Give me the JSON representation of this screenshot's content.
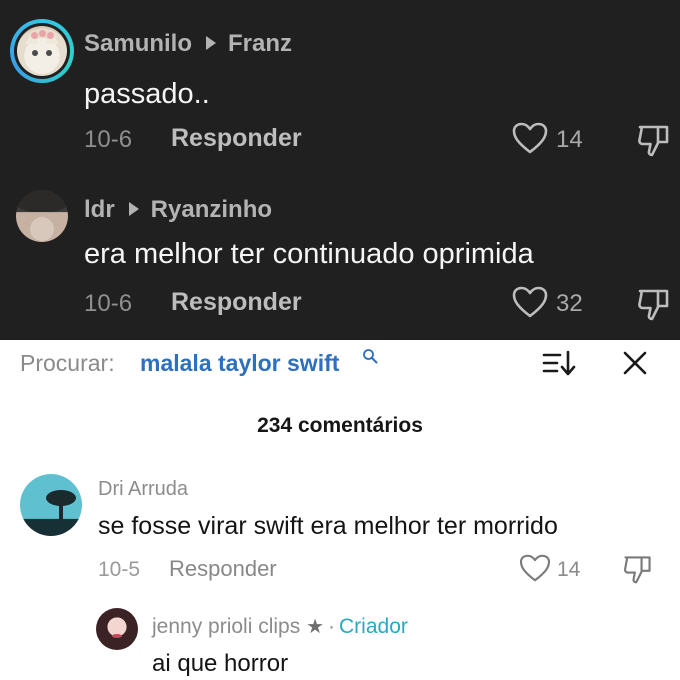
{
  "dark_comments": [
    {
      "author": "Samunilo",
      "reply_to": "Franz",
      "text": "passado..",
      "date": "10-6",
      "reply_label": "Responder",
      "likes": "14"
    },
    {
      "author": "ldr",
      "reply_to": "Ryanzinho",
      "text": "era melhor ter continuado oprimida",
      "date": "10-6",
      "reply_label": "Responder",
      "likes": "32"
    }
  ],
  "search": {
    "label": "Procurar:",
    "query": "malala taylor swift"
  },
  "comments_count": "234 comentários",
  "comment": {
    "author": "Dri Arruda",
    "text": "se fosse virar swift era melhor ter morrido",
    "date": "10-5",
    "reply_label": "Responder",
    "likes": "14"
  },
  "reply": {
    "author": "jenny prioli clips",
    "star": "★",
    "separator": "·",
    "creator_label": "Criador",
    "text": "ai que horror"
  },
  "colors": {
    "dark_bg": "#202020",
    "link_blue": "#2e6fbf",
    "creator_teal": "#29a9c4"
  }
}
